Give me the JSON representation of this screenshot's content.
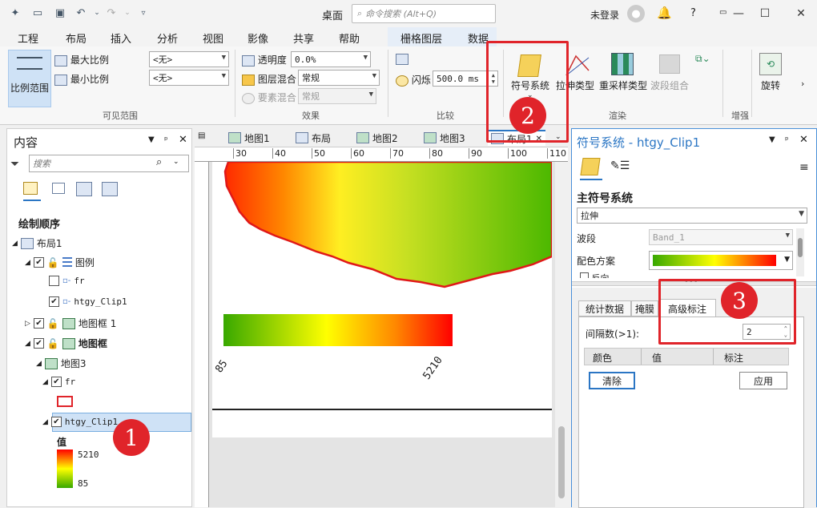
{
  "titlebar": {
    "title": "桌面",
    "search_placeholder": "命令搜索 (Alt+Q)",
    "login": "未登录",
    "help": "?"
  },
  "menu": {
    "items": [
      "工程",
      "布局",
      "插入",
      "分析",
      "视图",
      "影像",
      "共享",
      "帮助"
    ],
    "context_tabs": [
      "栅格图层",
      "数据"
    ]
  },
  "ribbon": {
    "scale_range": "比例范围",
    "max_scale": "最大比例",
    "min_scale": "最小比例",
    "scale_none1": "<无>",
    "scale_none2": "<无>",
    "visible_range": "可见范围",
    "transparency": "透明度",
    "transparency_val": "0.0%",
    "layer_blend": "图层混合",
    "layer_blend_val": "常规",
    "feature_blend": "要素混合",
    "feature_blend_val": "常规",
    "effects": "效果",
    "flicker": "闪烁",
    "flicker_val": "500.0 ms",
    "compare": "比较",
    "symbology": "符号系统",
    "stretch_type": "拉伸类型",
    "resample_type": "重采样类型",
    "band_combo": "波段组合",
    "rendering": "渲染",
    "enhance": "增强",
    "rotate": "旋转"
  },
  "contents": {
    "title": "内容",
    "search_placeholder": "搜索",
    "drawing_order": "绘制顺序",
    "items": {
      "layout": "布局1",
      "legend": "图例",
      "fr": "fr",
      "clip": "htgy_Clip1",
      "mapframe1": "地图框 1",
      "mapframe": "地图框",
      "map3": "地图3",
      "fr2": "fr",
      "clip2": "htgy_Clip1"
    },
    "value_label": "值",
    "max_val": "5210",
    "min_val": "85"
  },
  "doc_tabs": [
    "地图1",
    "布局",
    "地图2",
    "地图3",
    "布局1"
  ],
  "ruler": [
    "30",
    "40",
    "50",
    "60",
    "70",
    "80",
    "90",
    "100",
    "110"
  ],
  "map": {
    "legend_min": "85",
    "legend_max": "5210"
  },
  "symbology": {
    "title": "符号系统 - htgy_Clip1",
    "primary": "主符号系统",
    "primary_val": "拉伸",
    "band": "波段",
    "band_val": "Band_1",
    "color_scheme": "配色方案",
    "invert": "反向",
    "tabs": [
      "统计数据",
      "掩膜",
      "高级标注"
    ],
    "interval_label": "间隔数(>1):",
    "interval_val": "2",
    "table_cols": [
      "颜色",
      "值",
      "标注"
    ],
    "clear": "清除",
    "apply": "应用"
  },
  "markers": [
    "1",
    "2",
    "3"
  ],
  "colors": {
    "accent": "#2b76c4",
    "marker": "#e0242a",
    "ramp": [
      "#38a800",
      "#ffff00",
      "#ff0000"
    ]
  }
}
